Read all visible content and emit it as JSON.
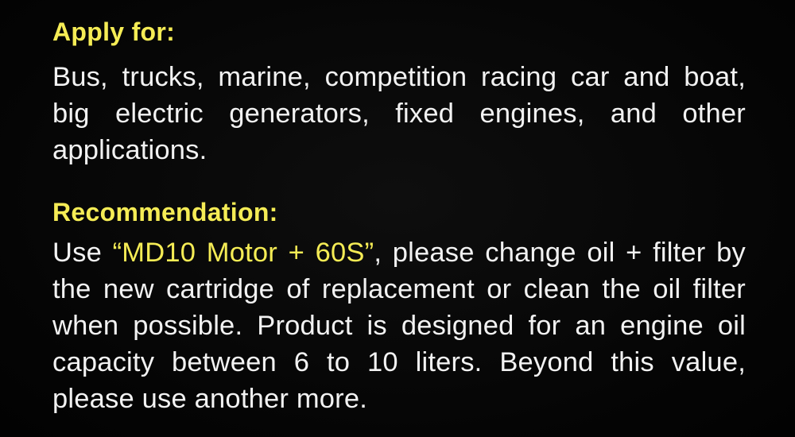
{
  "apply": {
    "heading": "Apply for:",
    "text": "Bus, trucks, marine, competition racing car and boat, big electric generators, fixed engines, and other applications."
  },
  "recommendation": {
    "heading": "Recommendation:",
    "lead": "Use ",
    "product": "“MD10 Motor + 60S”",
    "text": ", please change oil + filter by the new cartridge of replacement or clean the oil filter when possible. Product is designed for an engine oil capacity between 6 to 10 liters. Beyond this value, please use another more."
  },
  "colors": {
    "background": "#060606",
    "heading": "#f5ec55",
    "body": "#f2f2f2",
    "highlight": "#f5ec55"
  }
}
